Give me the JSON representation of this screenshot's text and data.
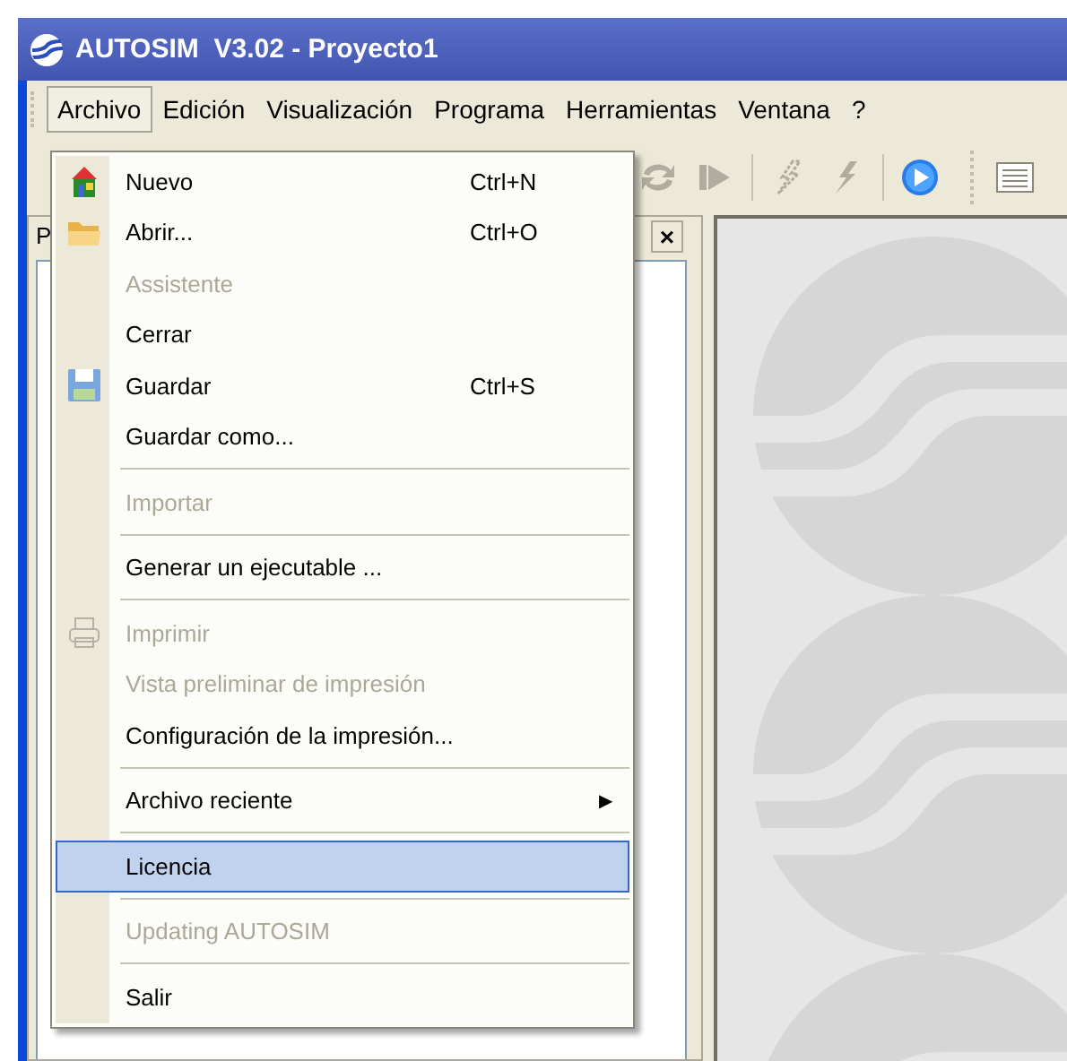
{
  "window": {
    "title": "AUTOSIM  V3.02 - Proyecto1"
  },
  "menu_bar": [
    {
      "label": "Archivo",
      "selected": true
    },
    {
      "label": "Edición",
      "selected": false
    },
    {
      "label": "Visualización",
      "selected": false
    },
    {
      "label": "Programa",
      "selected": false
    },
    {
      "label": "Herramientas",
      "selected": false
    },
    {
      "label": "Ventana",
      "selected": false
    },
    {
      "label": "?",
      "selected": false
    }
  ],
  "panel": {
    "tab": "P",
    "close": "×"
  },
  "file_menu": [
    {
      "kind": "item",
      "label": "Nuevo",
      "shortcut": "Ctrl+N",
      "disabled": false,
      "selected": false
    },
    {
      "kind": "item",
      "label": "Abrir...",
      "shortcut": "Ctrl+O",
      "disabled": false,
      "selected": false
    },
    {
      "kind": "item",
      "label": "Assistente",
      "disabled": true,
      "selected": false
    },
    {
      "kind": "item",
      "label": "Cerrar",
      "disabled": false,
      "selected": false
    },
    {
      "kind": "item",
      "label": "Guardar",
      "shortcut": "Ctrl+S",
      "disabled": false,
      "selected": false
    },
    {
      "kind": "item",
      "label": "Guardar como...",
      "disabled": false,
      "selected": false
    },
    {
      "kind": "separator"
    },
    {
      "kind": "item",
      "label": "Importar",
      "disabled": true,
      "selected": false
    },
    {
      "kind": "separator"
    },
    {
      "kind": "item",
      "label": "Generar un ejecutable ...",
      "disabled": false,
      "selected": false
    },
    {
      "kind": "separator"
    },
    {
      "kind": "item",
      "label": "Imprimir",
      "disabled": true,
      "selected": false
    },
    {
      "kind": "item",
      "label": "Vista preliminar de impresión",
      "disabled": true,
      "selected": false
    },
    {
      "kind": "item",
      "label": "Configuración de la impresión...",
      "disabled": false,
      "selected": false
    },
    {
      "kind": "separator"
    },
    {
      "kind": "submenu",
      "label": "Archivo reciente",
      "arrow": "▶",
      "disabled": false,
      "selected": false
    },
    {
      "kind": "separator"
    },
    {
      "kind": "item",
      "label": "Licencia",
      "disabled": false,
      "selected": true
    },
    {
      "kind": "separator"
    },
    {
      "kind": "item",
      "label": "Updating AUTOSIM",
      "disabled": true,
      "selected": false
    },
    {
      "kind": "separator"
    },
    {
      "kind": "item",
      "label": "Salir",
      "disabled": false,
      "selected": false
    }
  ]
}
